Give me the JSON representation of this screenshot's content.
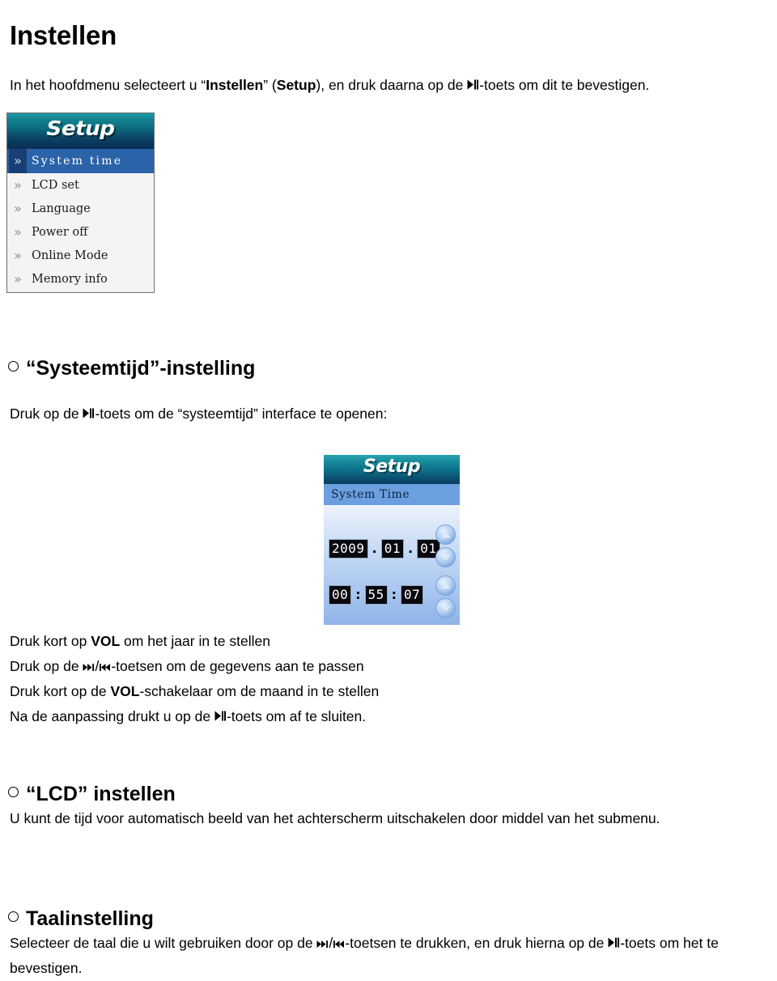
{
  "document": {
    "title": "Instellen",
    "intro": {
      "part1": "In het hoofdmenu selecteert u “",
      "bold1": "Instellen",
      "part2": "” (",
      "bold2": "Setup",
      "part3": "), en druk daarna op de ",
      "key": "play-pause-key",
      "part4": "-toets om dit te bevestigen."
    }
  },
  "screen_setup": {
    "logo": "Setup",
    "menu_items": [
      {
        "chevron": "»",
        "label": "System time",
        "selected": true
      },
      {
        "chevron": "»",
        "label": "LCD set",
        "selected": false
      },
      {
        "chevron": "»",
        "label": "Language",
        "selected": false
      },
      {
        "chevron": "»",
        "label": "Power off",
        "selected": false
      },
      {
        "chevron": "»",
        "label": "Online Mode",
        "selected": false
      },
      {
        "chevron": "»",
        "label": "Memory info",
        "selected": false
      }
    ],
    "colors": {
      "header_top": "#1f9aa8",
      "header_bottom": "#0a2f55",
      "selected_row": "#2a63a8",
      "selected_chevron": "#173f74",
      "list_bg": "#f4f4f4"
    }
  },
  "section_systeemtijd": {
    "heading": "“Systeemtijd”-instelling",
    "intro_before": "Druk op de ",
    "intro_key": "play-pause-key",
    "intro_after": "-toets om de “systeemtijd” interface te openen:",
    "instructions": {
      "line1_a": "Druk kort op ",
      "line1_bold": "VOL",
      "line1_b": " om het jaar in te stellen",
      "line2_a": "Druk op de ",
      "line2_key1": "skip-forward-key",
      "line2_slash": "/",
      "line2_key2": "skip-backward-key",
      "line2_b": "-toetsen om de gegevens aan te passen",
      "line3_a": "Druk kort op de ",
      "line3_bold": "VOL",
      "line3_b": "-schakelaar om de maand in te stellen",
      "line4_a": "Na de aanpassing drukt u op de ",
      "line4_key": "play-pause-key",
      "line4_b": "-toets om af te sluiten."
    }
  },
  "screen_system_time": {
    "logo": "Setup",
    "subtitle": "System Time",
    "date": {
      "year": "2009",
      "sep1": ".",
      "month": "01",
      "sep2": ".",
      "day": "01"
    },
    "time": {
      "hour": "00",
      "sep1": ":",
      "minute": "55",
      "sep2": ":",
      "second": "07"
    },
    "arrow_buttons": [
      {
        "name": "date-up",
        "glyph": "up"
      },
      {
        "name": "date-down",
        "glyph": "down"
      },
      {
        "name": "time-up",
        "glyph": "up"
      },
      {
        "name": "time-down",
        "glyph": "down"
      }
    ],
    "colors": {
      "header_top": "#27a3ae",
      "header_bottom": "#093f5e",
      "subbar": "#6c9fe0",
      "body_top": "#eef3fb",
      "body_bottom": "#8fb4e8",
      "lcd_bg": "#08080f",
      "lcd_fg": "#ffffff"
    }
  },
  "section_lcd": {
    "heading": "“LCD” instellen",
    "body": "U kunt de tijd voor automatisch beeld van het achterscherm uitschakelen door middel van het submenu."
  },
  "section_taal": {
    "heading": "Taalinstelling",
    "body_a": "Selecteer de taal die u wilt gebruiken door op de ",
    "key1": "skip-forward-key",
    "slash": "/",
    "key2": "skip-backward-key",
    "body_b": "-toetsen te drukken, en druk hierna op de ",
    "key3": "play-pause-key",
    "body_c": "-toets om het te bevestigen."
  }
}
